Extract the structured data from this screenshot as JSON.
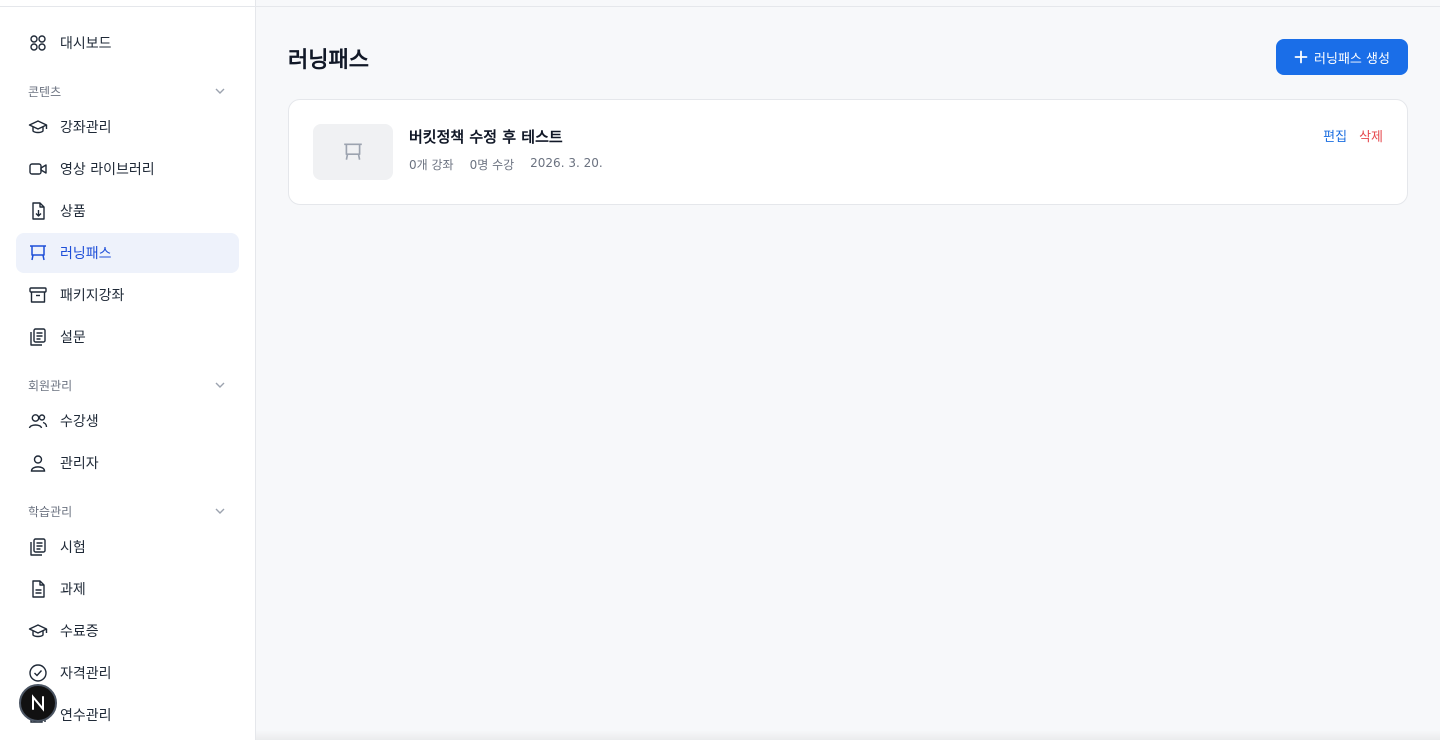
{
  "sidebar": {
    "items": [
      {
        "label": "대시보드",
        "icon": "dashboard-grid-icon"
      },
      {
        "label": "강좌관리",
        "icon": "graduation-cap-icon"
      },
      {
        "label": "영상 라이브러리",
        "icon": "video-camera-icon"
      },
      {
        "label": "상품",
        "icon": "file-download-icon"
      },
      {
        "label": "러닝패스",
        "icon": "presentation-board-icon"
      },
      {
        "label": "패키지강좌",
        "icon": "archive-box-icon"
      },
      {
        "label": "설문",
        "icon": "clipboard-icon"
      },
      {
        "label": "수강생",
        "icon": "users-icon"
      },
      {
        "label": "관리자",
        "icon": "user-icon"
      },
      {
        "label": "시험",
        "icon": "clipboard-icon"
      },
      {
        "label": "과제",
        "icon": "file-text-icon"
      },
      {
        "label": "수료증",
        "icon": "graduation-cap-icon"
      },
      {
        "label": "자격관리",
        "icon": "check-circle-icon"
      },
      {
        "label": "연수관리",
        "icon": "book-icon"
      }
    ],
    "sections": [
      {
        "label": "콘텐츠"
      },
      {
        "label": "회원관리"
      },
      {
        "label": "학습관리"
      }
    ],
    "active_item": "러닝패스",
    "avatar_letter": "N"
  },
  "main": {
    "title": "러닝패스",
    "create_button_label": "러닝패스 생성",
    "cards": [
      {
        "title": "버킷정책 수정 후 테스트",
        "course_count": "0개 강좌",
        "student_count": "0명 수강",
        "date": "2026. 3. 20.",
        "edit_label": "편집",
        "delete_label": "삭제"
      }
    ]
  },
  "colors": {
    "accent": "#1a6ee8",
    "active_bg": "#eef2fb",
    "danger": "#e5484d"
  }
}
